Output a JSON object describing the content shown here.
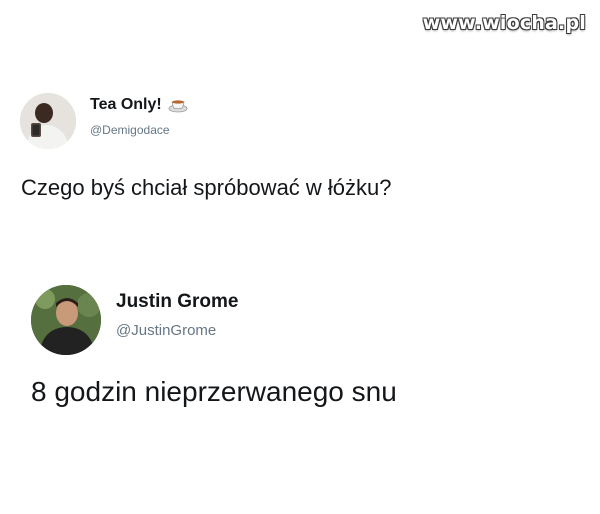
{
  "watermark": "www.wiocha.pl",
  "tweets": [
    {
      "display_name": "Tea Only!",
      "handle": "@Demigodace",
      "text": "Czego byś chciał spróbować w łóżku?",
      "name_emoji": "teacup-icon"
    },
    {
      "display_name": "Justin Grome",
      "handle": "@JustinGrome",
      "text": "8 godzin nieprzerwanego snu"
    }
  ],
  "colors": {
    "text": "#14171a",
    "handle": "#657786",
    "background": "#ffffff"
  }
}
